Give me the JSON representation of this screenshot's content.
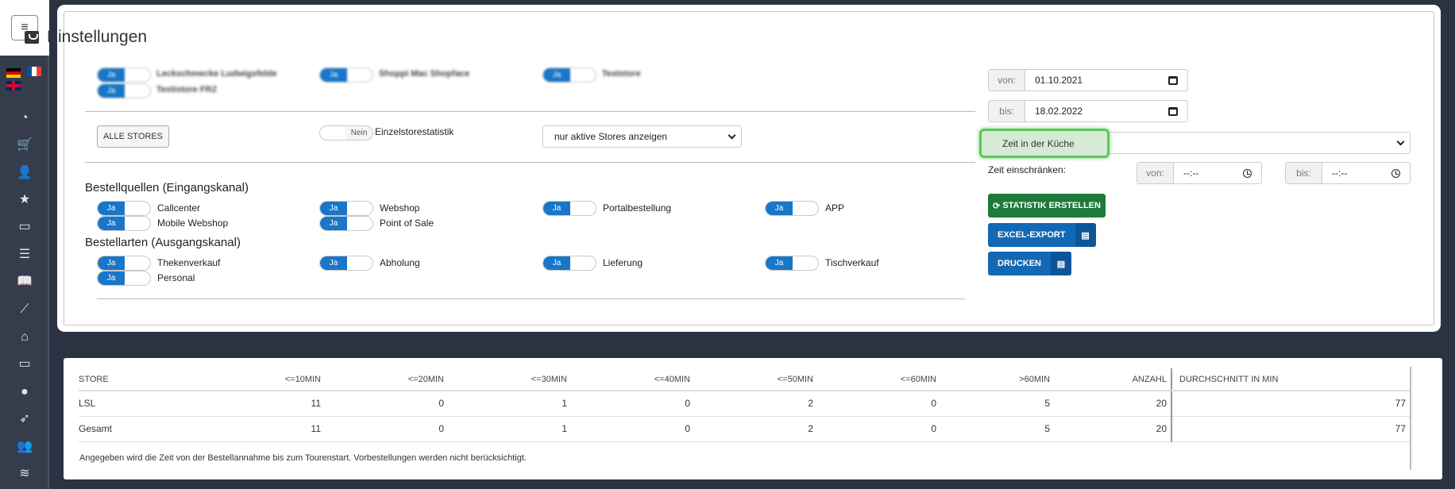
{
  "nav": {
    "icons": [
      "menu-icon",
      "tachometer-icon",
      "cart-icon",
      "user-plus-icon",
      "star-icon",
      "archive-icon",
      "list-icon",
      "book-icon",
      "chart-line-icon",
      "home-icon",
      "monitor-icon",
      "user-icon",
      "rocket-icon",
      "users-icon",
      "database-icon"
    ],
    "glyphs": [
      "≡",
      "◔",
      "🛒",
      "👤",
      "★",
      "▭",
      "☰",
      "📖",
      "⟋",
      "⌂",
      "▭",
      "●",
      "➶",
      "👥",
      "≋"
    ]
  },
  "page": {
    "title": "Einstellungen"
  },
  "stores": [
    {
      "toggle": "Ja",
      "name": "Leckschmecke Ludwigsfelde"
    },
    {
      "toggle": "Ja",
      "name": "Testistore FRZ"
    },
    {
      "toggle": "Ja",
      "name": "Shoppi Mac Shopface"
    },
    {
      "toggle": "Ja",
      "name": "Teststore"
    }
  ],
  "buttons": {
    "all_stores": "ALLE STORES",
    "stats": "STATISTIK ERSTELLEN",
    "excel": "EXCEL-EXPORT",
    "print": "DRUCKEN"
  },
  "einzelstore": {
    "toggle": "Nein",
    "label": "Einzelstorestatistik"
  },
  "filter_select": "nur aktive Stores anzeigen",
  "date": {
    "von_label": "von:",
    "von": "01.10.2021",
    "bis_label": "bis:",
    "bis": "18.02.2022"
  },
  "mode_select": "Zeit in der Küche",
  "time": {
    "label": "Zeit einschränken:",
    "von_label": "von:",
    "von": "--:--",
    "bis_label": "bis:",
    "bis": "--:--"
  },
  "sources": {
    "title": "Bestellquellen (Eingangskanal)",
    "items": [
      {
        "toggle": "Ja",
        "label": "Callcenter"
      },
      {
        "toggle": "Ja",
        "label": "Webshop"
      },
      {
        "toggle": "Ja",
        "label": "Portalbestellung"
      },
      {
        "toggle": "Ja",
        "label": "APP"
      },
      {
        "toggle": "Ja",
        "label": "Mobile Webshop"
      },
      {
        "toggle": "Ja",
        "label": "Point of Sale"
      }
    ]
  },
  "types": {
    "title": "Bestellarten (Ausgangskanal)",
    "items": [
      {
        "toggle": "Ja",
        "label": "Thekenverkauf"
      },
      {
        "toggle": "Ja",
        "label": "Abholung"
      },
      {
        "toggle": "Ja",
        "label": "Lieferung"
      },
      {
        "toggle": "Ja",
        "label": "Tischverkauf"
      },
      {
        "toggle": "Ja",
        "label": "Personal"
      }
    ]
  },
  "table": {
    "headers": [
      "STORE",
      "<=10MIN",
      "<=20MIN",
      "<=30MIN",
      "<=40MIN",
      "<=50MIN",
      "<=60MIN",
      ">60MIN",
      "ANZAHL",
      "DURCHSCHNITT IN MIN"
    ],
    "rows": [
      [
        "LSL",
        "11",
        "0",
        "1",
        "0",
        "2",
        "0",
        "5",
        "20",
        "77"
      ],
      [
        "Gesamt",
        "11",
        "0",
        "1",
        "0",
        "2",
        "0",
        "5",
        "20",
        "77"
      ]
    ],
    "note": "Angegeben wird die Zeit von der Bestellannahme bis zum Tourenstart. Vorbestellungen werden nicht berücksichtigt."
  },
  "colors": {
    "primary": "#1976c8",
    "success": "#1e7a3a",
    "highlight": "#5ac85a"
  }
}
